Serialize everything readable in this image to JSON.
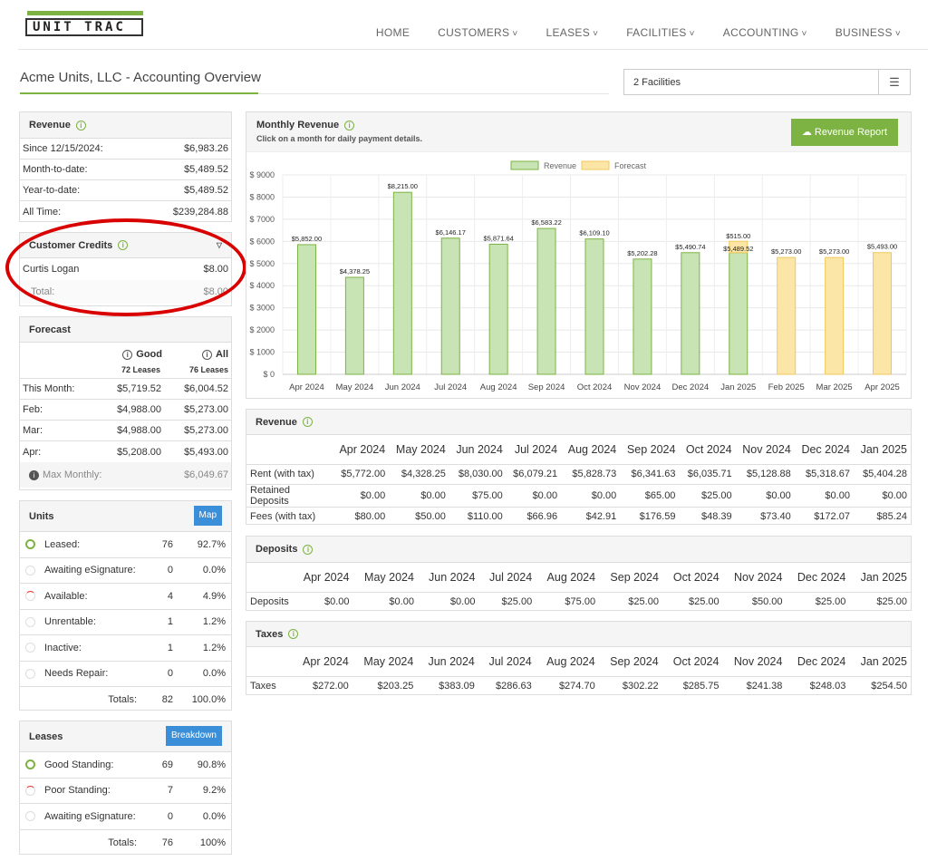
{
  "brand": {
    "logo": "UNIT TRAC"
  },
  "nav": [
    "HOME",
    "CUSTOMERS",
    "LEASES",
    "FACILITIES",
    "ACCOUNTING",
    "BUSINESS"
  ],
  "page_title": "Acme Units, LLC - Accounting Overview",
  "facility_select": "2 Facilities",
  "revenue": {
    "title": "Revenue",
    "rows": [
      [
        "Since 12/15/2024:",
        "$6,983.26"
      ],
      [
        "Month-to-date:",
        "$5,489.52"
      ],
      [
        "Year-to-date:",
        "$5,489.52"
      ],
      [
        "All Time:",
        "$239,284.88"
      ]
    ]
  },
  "credits": {
    "title": "Customer Credits",
    "rows": [
      [
        "Curtis Logan",
        "$8.00"
      ]
    ],
    "total_label": "Total:",
    "total": "$8.00"
  },
  "forecast": {
    "title": "Forecast",
    "col1": "Good",
    "col1_sub": "72 Leases",
    "col2": "All",
    "col2_sub": "76 Leases",
    "rows": [
      [
        "This Month:",
        "$5,719.52",
        "$6,004.52"
      ],
      [
        "Feb:",
        "$4,988.00",
        "$5,273.00"
      ],
      [
        "Mar:",
        "$4,988.00",
        "$5,273.00"
      ],
      [
        "Apr:",
        "$5,208.00",
        "$5,493.00"
      ]
    ],
    "max_label": "Max Monthly:",
    "max": "$6,049.67"
  },
  "units": {
    "title": "Units",
    "btn": "Map",
    "rows": [
      [
        "Leased:",
        "76",
        "92.7%"
      ],
      [
        "Awaiting eSignature:",
        "0",
        "0.0%"
      ],
      [
        "Available:",
        "4",
        "4.9%"
      ],
      [
        "Unrentable:",
        "1",
        "1.2%"
      ],
      [
        "Inactive:",
        "1",
        "1.2%"
      ],
      [
        "Needs Repair:",
        "0",
        "0.0%"
      ]
    ],
    "totals": [
      "Totals:",
      "82",
      "100.0%"
    ]
  },
  "leases": {
    "title": "Leases",
    "btn": "Breakdown",
    "rows": [
      [
        "Good Standing:",
        "69",
        "90.8%"
      ],
      [
        "Poor Standing:",
        "7",
        "9.2%"
      ],
      [
        "Awaiting eSignature:",
        "0",
        "0.0%"
      ]
    ],
    "totals": [
      "Totals:",
      "76",
      "100%"
    ]
  },
  "monthly": {
    "title": "Monthly Revenue",
    "subtitle": "Click on a month for daily payment details.",
    "btn": "Revenue Report"
  },
  "chart_data": {
    "type": "bar",
    "categories": [
      "Apr 2024",
      "May 2024",
      "Jun 2024",
      "Jul 2024",
      "Aug 2024",
      "Sep 2024",
      "Oct 2024",
      "Nov 2024",
      "Dec 2024",
      "Jan 2025",
      "Feb 2025",
      "Mar 2025",
      "Apr 2025"
    ],
    "series": [
      {
        "name": "Revenue",
        "values": [
          5852.0,
          4378.25,
          8215.0,
          6146.17,
          5871.64,
          6583.22,
          6109.1,
          5202.28,
          5490.74,
          5489.52,
          null,
          null,
          null
        ],
        "color": "#c9e4b4"
      },
      {
        "name": "Forecast",
        "values": [
          null,
          null,
          null,
          null,
          null,
          null,
          null,
          null,
          null,
          515.0,
          5273.0,
          5273.0,
          5493.0
        ],
        "color": "#fbe6a8"
      }
    ],
    "labels": [
      "$5,852.00",
      "$4,378.25",
      "$8,215.00",
      "$6,146.17",
      "$5,871.64",
      "$6,583.22",
      "$6,109.10",
      "$5,202.28",
      "$5,490.74",
      "$5,489.52",
      "$5,273.00",
      "$5,273.00",
      "$5,493.00"
    ],
    "forecast_stack_label": "$515.00",
    "yticks": [
      "$ 0",
      "$ 1000",
      "$ 2000",
      "$ 3000",
      "$ 4000",
      "$ 5000",
      "$ 6000",
      "$ 7000",
      "$ 8000",
      "$ 9000"
    ],
    "ylim": [
      0,
      9000
    ],
    "legend": "top-center"
  },
  "rev_table": {
    "title": "Revenue",
    "months": [
      "Apr 2024",
      "May 2024",
      "Jun 2024",
      "Jul 2024",
      "Aug 2024",
      "Sep 2024",
      "Oct 2024",
      "Nov 2024",
      "Dec 2024",
      "Jan 2025"
    ],
    "rows": [
      [
        "Rent (with tax)",
        "$5,772.00",
        "$4,328.25",
        "$8,030.00",
        "$6,079.21",
        "$5,828.73",
        "$6,341.63",
        "$6,035.71",
        "$5,128.88",
        "$5,318.67",
        "$5,404.28"
      ],
      [
        "Retained Deposits",
        "$0.00",
        "$0.00",
        "$75.00",
        "$0.00",
        "$0.00",
        "$65.00",
        "$25.00",
        "$0.00",
        "$0.00",
        "$0.00"
      ],
      [
        "Fees (with tax)",
        "$80.00",
        "$50.00",
        "$110.00",
        "$66.96",
        "$42.91",
        "$176.59",
        "$48.39",
        "$73.40",
        "$172.07",
        "$85.24"
      ]
    ]
  },
  "dep_table": {
    "title": "Deposits",
    "rows": [
      [
        "Deposits",
        "$0.00",
        "$0.00",
        "$0.00",
        "$25.00",
        "$75.00",
        "$25.00",
        "$25.00",
        "$50.00",
        "$25.00",
        "$25.00"
      ]
    ]
  },
  "tax_table": {
    "title": "Taxes",
    "rows": [
      [
        "Taxes",
        "$272.00",
        "$203.25",
        "$383.09",
        "$286.63",
        "$274.70",
        "$302.22",
        "$285.75",
        "$241.38",
        "$248.03",
        "$254.50"
      ]
    ]
  }
}
